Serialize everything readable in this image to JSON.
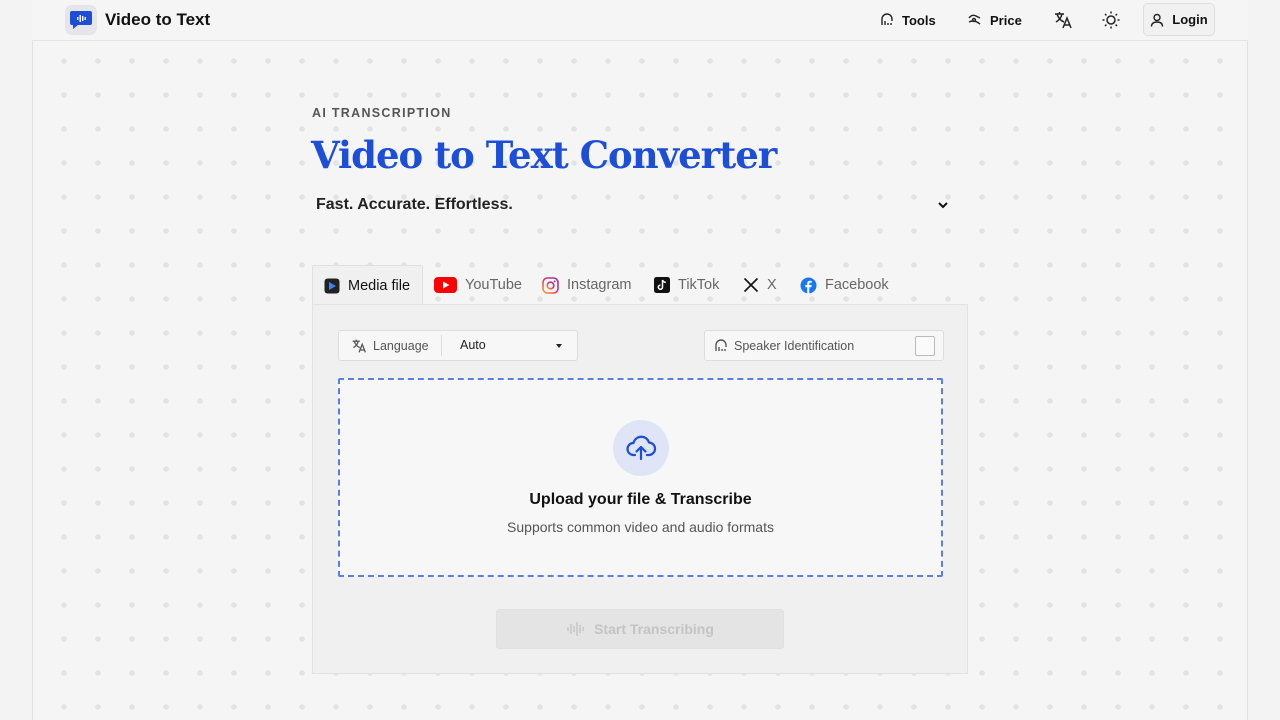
{
  "header": {
    "brand": "Video to Text",
    "nav": {
      "tools": "Tools",
      "price": "Price"
    },
    "login": "Login",
    "icons": {
      "logo": "chat-waveform-icon",
      "language": "translate-icon",
      "theme": "sun-icon",
      "user": "user-icon"
    }
  },
  "hero": {
    "eyebrow": "AI TRANSCRIPTION",
    "title": "Video to Text Converter",
    "subtitle": "Fast. Accurate. Effortless."
  },
  "tabs": [
    {
      "label": "Media file",
      "icon": "media-file-icon",
      "active": true
    },
    {
      "label": "YouTube",
      "icon": "youtube-icon",
      "active": false
    },
    {
      "label": "Instagram",
      "icon": "instagram-icon",
      "active": false
    },
    {
      "label": "TikTok",
      "icon": "tiktok-icon",
      "active": false
    },
    {
      "label": "X",
      "icon": "x-icon",
      "active": false
    },
    {
      "label": "Facebook",
      "icon": "facebook-icon",
      "active": false
    }
  ],
  "options": {
    "language_label": "Language",
    "language_value": "Auto",
    "speaker_label": "Speaker Identification",
    "speaker_checked": false
  },
  "upload": {
    "title": "Upload your file & Transcribe",
    "subtitle": "Supports common video and audio formats"
  },
  "start_button": "Start Transcribing",
  "colors": {
    "accent": "#1d4ed8",
    "dropzone_border": "#5b7fe0",
    "youtube": "#ff0000",
    "facebook": "#1877f2"
  }
}
